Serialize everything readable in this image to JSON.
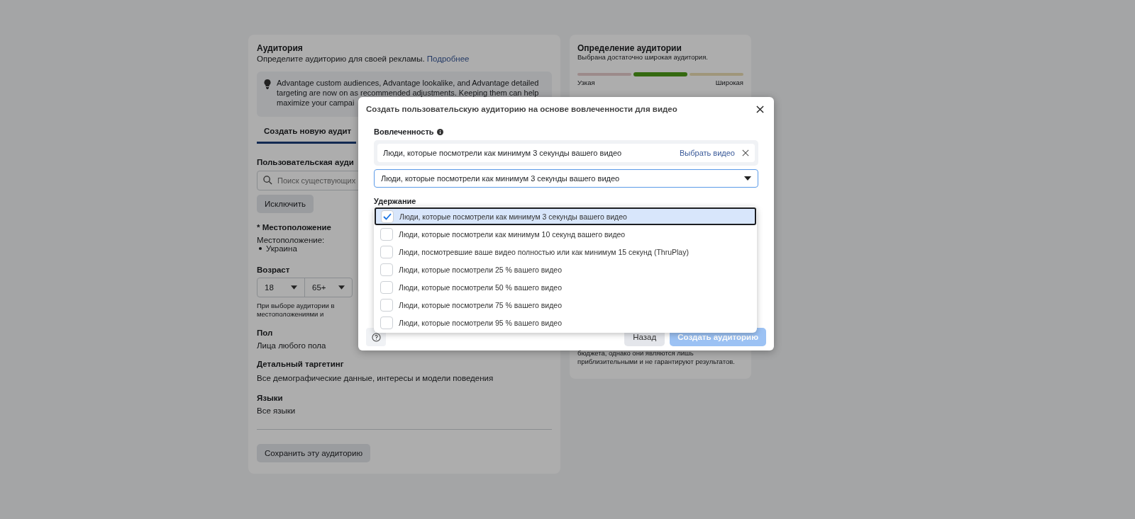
{
  "audience_panel": {
    "title": "Аудитория",
    "subtitle": "Определите аудиторию для своей рекламы.",
    "link": "Подробнее",
    "notice_lines": [
      "Advantage custom audiences, Advantage lookalike, and Advantage detailed",
      "targeting are now on as recommended adjustments. Keeping them can help",
      "maximize your campai"
    ],
    "tab": {
      "label": "Создать новую аудит",
      "selected": true
    },
    "custom_audience_label": "Пользовательская ауди",
    "search_placeholder": "Поиск существующих",
    "exclude_button": "Исключить",
    "location_heading": "* Местоположение",
    "location_label": "Местоположение:",
    "locations": [
      "Украина"
    ],
    "age_heading": "Возраст",
    "age_min": "18",
    "age_max": "65+",
    "age_note_lines": [
      "При выборе аудитории в",
      "местоположениями и"
    ],
    "gender_heading": "Пол",
    "gender_value": "Лица любого пола",
    "detailed_heading": "Детальный таргетинг",
    "detailed_value": "Все демографические данные, интересы и модели поведения",
    "languages_heading": "Языки",
    "languages_value": "Все языки",
    "save_button": "Сохранить эту аудиторию"
  },
  "definition_panel": {
    "title": "Определение аудитории",
    "text": "Выбрана достаточно широкая аудитория.",
    "meter": {
      "segments": [
        {
          "color": "#9c8a8a",
          "active": false
        },
        {
          "color": "#346910",
          "active": true
        },
        {
          "color": "#9f967a",
          "active": false
        }
      ],
      "narrow_label": "Узкая",
      "wide_label": "Широкая"
    },
    "note_lines": [
      "бюджета, однако они являются лишь",
      "приблизительными и не гарантируют результатов."
    ]
  },
  "dialog": {
    "title": "Создать пользовательскую аудиторию на основе вовлеченности для видео",
    "engagement_label": "Вовлеченность",
    "selected_chip": {
      "text": "Люди, которые посмотрели как минимум 3 секунды вашего видео",
      "link": "Выбрать видео"
    },
    "select_value": "Люди, которые посмотрели как минимум 3 секунды вашего видео",
    "retention_label": "Удержание",
    "options": [
      {
        "label": "Люди, которые посмотрели как минимум 3 секунды вашего видео",
        "checked": true,
        "selected": true
      },
      {
        "label": "Люди, которые посмотрели как минимум 10 секунд вашего видео",
        "checked": false,
        "selected": false
      },
      {
        "label": "Люди, посмотревшие ваше видео полностью или как минимум 15 секунд (ThruPlay)",
        "checked": false,
        "selected": false
      },
      {
        "label": "Люди, которые посмотрели 25 % вашего видео",
        "checked": false,
        "selected": false
      },
      {
        "label": "Люди, которые посмотрели 50 % вашего видео",
        "checked": false,
        "selected": false
      },
      {
        "label": "Люди, которые посмотрели 75 % вашего видео",
        "checked": false,
        "selected": false
      },
      {
        "label": "Люди, которые посмотрели 95 % вашего видео",
        "checked": false,
        "selected": false
      }
    ],
    "back_button": "Назад",
    "create_button": {
      "label": "Создать аудиторию",
      "disabled": true
    }
  }
}
